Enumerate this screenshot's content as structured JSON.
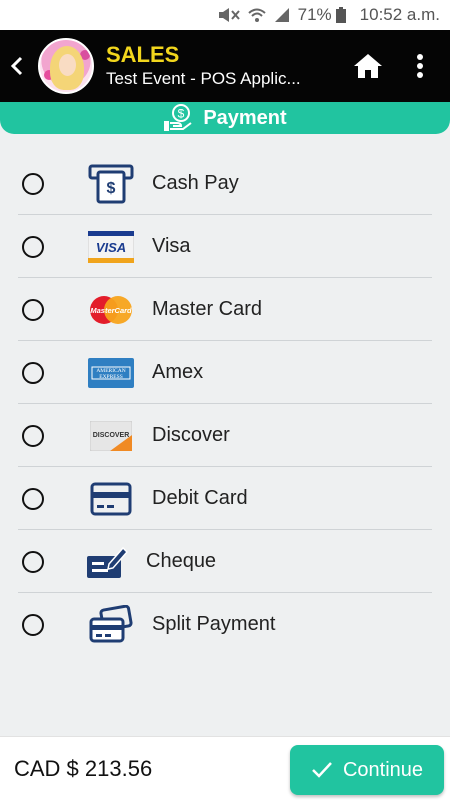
{
  "status_bar": {
    "battery_pct": "71%",
    "time": "10:52 a.m."
  },
  "header": {
    "title": "SALES",
    "subtitle": "Test Event - POS Applic..."
  },
  "section": {
    "title": "Payment"
  },
  "payment_methods": [
    {
      "label": "Cash Pay",
      "icon": "atm-cash-icon",
      "selected": false
    },
    {
      "label": "Visa",
      "icon": "visa-card-icon",
      "selected": false
    },
    {
      "label": "Master Card",
      "icon": "mastercard-icon",
      "selected": false
    },
    {
      "label": "Amex",
      "icon": "amex-card-icon",
      "selected": false
    },
    {
      "label": "Discover",
      "icon": "discover-card-icon",
      "selected": false
    },
    {
      "label": "Debit Card",
      "icon": "debit-card-icon",
      "selected": false
    },
    {
      "label": "Cheque",
      "icon": "cheque-icon",
      "selected": false
    },
    {
      "label": "Split Payment",
      "icon": "split-payment-icon",
      "selected": false
    }
  ],
  "footer": {
    "total": "CAD $ 213.56",
    "continue_label": "Continue"
  },
  "colors": {
    "accent": "#21c4a0",
    "header_bg": "#050505",
    "title_yellow": "#f2d61d",
    "icon_navy": "#1f3d73"
  }
}
